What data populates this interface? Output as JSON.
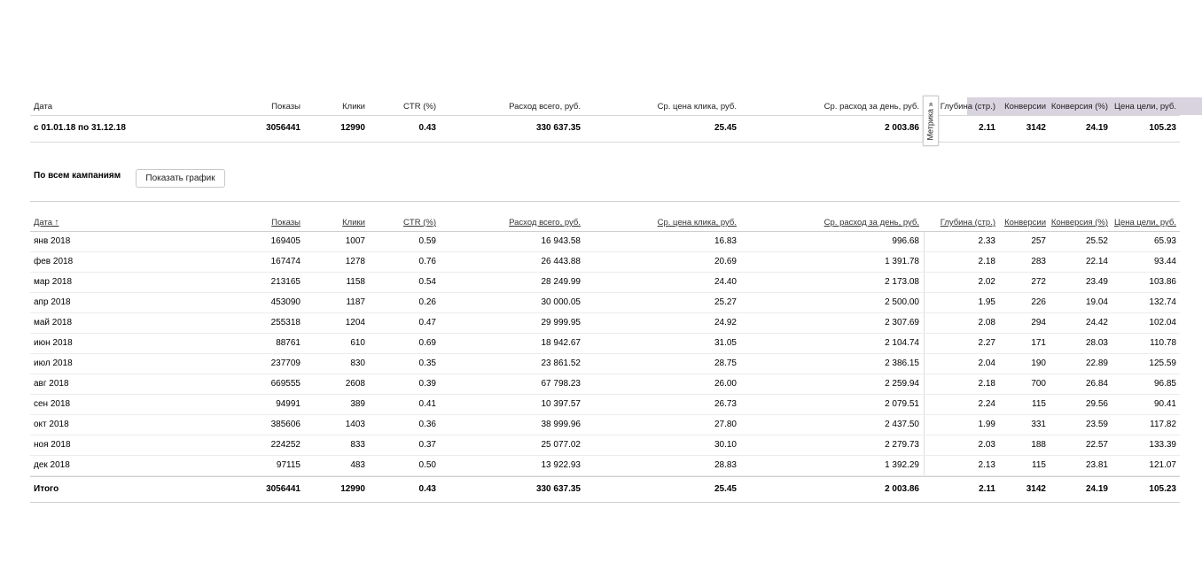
{
  "columns": {
    "date": "Дата",
    "shows": "Показы",
    "clicks": "Клики",
    "ctr": "CTR (%)",
    "spend": "Расход всего, руб.",
    "cpc": "Ср. цена клика, руб.",
    "daily": "Ср. расход за день, руб.",
    "depth": "Глубина (стр.)",
    "conv": "Конверсии",
    "conv_rate": "Конверсия (%)",
    "goal_price": "Цена цели, руб."
  },
  "sorted_date_header": "Дата ↑",
  "metrika_label": "Метрика »",
  "summary": {
    "date": "с 01.01.18 по 31.12.18",
    "shows": "3056441",
    "clicks": "12990",
    "ctr": "0.43",
    "spend": "330 637.35",
    "cpc": "25.45",
    "daily": "2 003.86",
    "depth": "2.11",
    "conv": "3142",
    "conv_rate": "24.19",
    "goal_price": "105.23"
  },
  "campaign": {
    "title": "По всем кампаниям",
    "chart_button": "Показать график"
  },
  "rows": [
    {
      "date": "янв 2018",
      "shows": "169405",
      "clicks": "1007",
      "ctr": "0.59",
      "spend": "16 943.58",
      "cpc": "16.83",
      "daily": "996.68",
      "depth": "2.33",
      "conv": "257",
      "conv_rate": "25.52",
      "goal_price": "65.93"
    },
    {
      "date": "фев 2018",
      "shows": "167474",
      "clicks": "1278",
      "ctr": "0.76",
      "spend": "26 443.88",
      "cpc": "20.69",
      "daily": "1 391.78",
      "depth": "2.18",
      "conv": "283",
      "conv_rate": "22.14",
      "goal_price": "93.44"
    },
    {
      "date": "мар 2018",
      "shows": "213165",
      "clicks": "1158",
      "ctr": "0.54",
      "spend": "28 249.99",
      "cpc": "24.40",
      "daily": "2 173.08",
      "depth": "2.02",
      "conv": "272",
      "conv_rate": "23.49",
      "goal_price": "103.86"
    },
    {
      "date": "апр 2018",
      "shows": "453090",
      "clicks": "1187",
      "ctr": "0.26",
      "spend": "30 000.05",
      "cpc": "25.27",
      "daily": "2 500.00",
      "depth": "1.95",
      "conv": "226",
      "conv_rate": "19.04",
      "goal_price": "132.74"
    },
    {
      "date": "май 2018",
      "shows": "255318",
      "clicks": "1204",
      "ctr": "0.47",
      "spend": "29 999.95",
      "cpc": "24.92",
      "daily": "2 307.69",
      "depth": "2.08",
      "conv": "294",
      "conv_rate": "24.42",
      "goal_price": "102.04"
    },
    {
      "date": "июн 2018",
      "shows": "88761",
      "clicks": "610",
      "ctr": "0.69",
      "spend": "18 942.67",
      "cpc": "31.05",
      "daily": "2 104.74",
      "depth": "2.27",
      "conv": "171",
      "conv_rate": "28.03",
      "goal_price": "110.78"
    },
    {
      "date": "июл 2018",
      "shows": "237709",
      "clicks": "830",
      "ctr": "0.35",
      "spend": "23 861.52",
      "cpc": "28.75",
      "daily": "2 386.15",
      "depth": "2.04",
      "conv": "190",
      "conv_rate": "22.89",
      "goal_price": "125.59"
    },
    {
      "date": "авг 2018",
      "shows": "669555",
      "clicks": "2608",
      "ctr": "0.39",
      "spend": "67 798.23",
      "cpc": "26.00",
      "daily": "2 259.94",
      "depth": "2.18",
      "conv": "700",
      "conv_rate": "26.84",
      "goal_price": "96.85"
    },
    {
      "date": "сен 2018",
      "shows": "94991",
      "clicks": "389",
      "ctr": "0.41",
      "spend": "10 397.57",
      "cpc": "26.73",
      "daily": "2 079.51",
      "depth": "2.24",
      "conv": "115",
      "conv_rate": "29.56",
      "goal_price": "90.41"
    },
    {
      "date": "окт 2018",
      "shows": "385606",
      "clicks": "1403",
      "ctr": "0.36",
      "spend": "38 999.96",
      "cpc": "27.80",
      "daily": "2 437.50",
      "depth": "1.99",
      "conv": "331",
      "conv_rate": "23.59",
      "goal_price": "117.82"
    },
    {
      "date": "ноя 2018",
      "shows": "224252",
      "clicks": "833",
      "ctr": "0.37",
      "spend": "25 077.02",
      "cpc": "30.10",
      "daily": "2 279.73",
      "depth": "2.03",
      "conv": "188",
      "conv_rate": "22.57",
      "goal_price": "133.39"
    },
    {
      "date": "дек 2018",
      "shows": "97115",
      "clicks": "483",
      "ctr": "0.50",
      "spend": "13 922.93",
      "cpc": "28.83",
      "daily": "1 392.29",
      "depth": "2.13",
      "conv": "115",
      "conv_rate": "23.81",
      "goal_price": "121.07"
    }
  ],
  "total": {
    "date": "Итого",
    "shows": "3056441",
    "clicks": "12990",
    "ctr": "0.43",
    "spend": "330 637.35",
    "cpc": "25.45",
    "daily": "2 003.86",
    "depth": "2.11",
    "conv": "3142",
    "conv_rate": "24.19",
    "goal_price": "105.23"
  },
  "colors": {
    "metrika_header_bg": "#d9d2df",
    "border": "#cfcfcf"
  }
}
